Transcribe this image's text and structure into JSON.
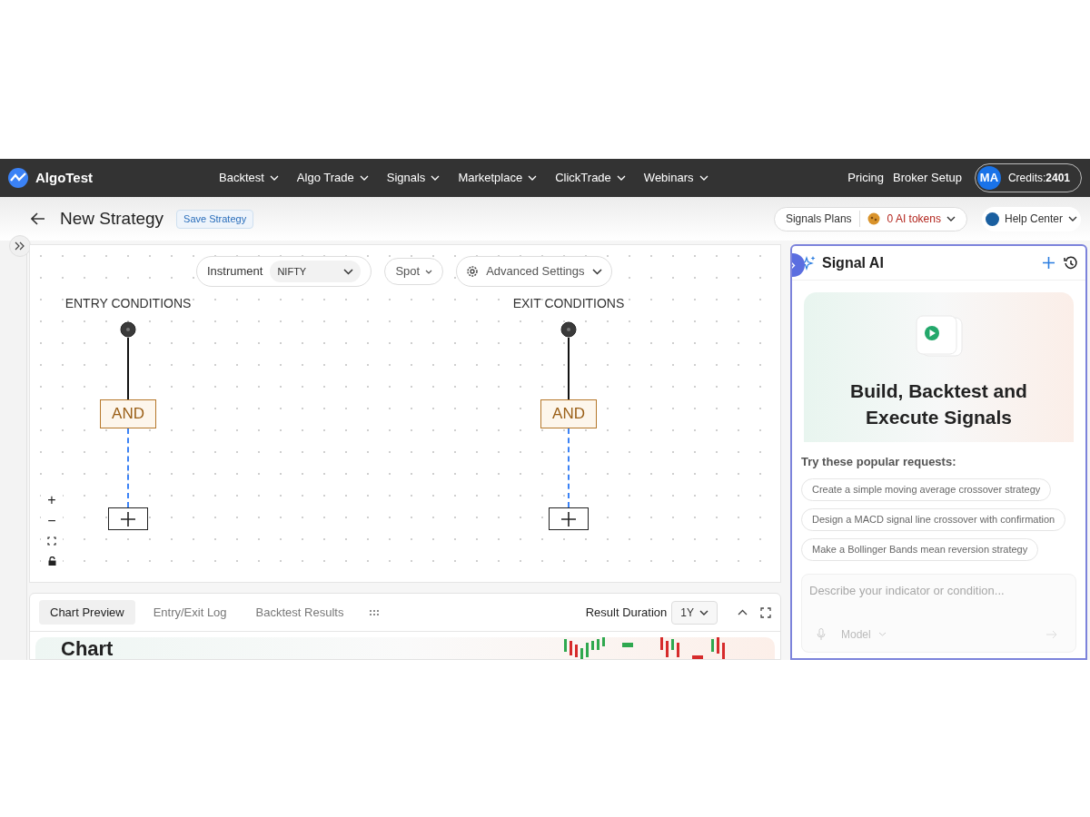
{
  "nav": {
    "brand": "AlgoTest",
    "menus": [
      {
        "label": "Backtest"
      },
      {
        "label": "Algo Trade"
      },
      {
        "label": "Signals"
      },
      {
        "label": "Marketplace"
      },
      {
        "label": "ClickTrade"
      },
      {
        "label": "Webinars"
      }
    ],
    "links": [
      "Pricing",
      "Broker Setup"
    ],
    "avatar": "MA",
    "credits_label": "Credits:",
    "credits_value": "2401"
  },
  "header": {
    "title": "New Strategy",
    "save_button": "Save Strategy",
    "signals_plans": "Signals Plans",
    "tokens": "0 AI tokens",
    "help": "Help Center"
  },
  "canvas": {
    "instrument_label": "Instrument",
    "instrument_value": "NIFTY",
    "spot": "Spot",
    "advanced": "Advanced Settings",
    "branches": [
      {
        "title": "ENTRY CONDITIONS",
        "operator": "AND"
      },
      {
        "title": "EXIT CONDITIONS",
        "operator": "AND"
      }
    ],
    "zoom_controls": [
      "+",
      "−"
    ]
  },
  "bottom_panel": {
    "tabs": [
      {
        "label": "Chart Preview",
        "selected": true
      },
      {
        "label": "Entry/Exit Log",
        "selected": false
      },
      {
        "label": "Backtest Results",
        "selected": false
      }
    ],
    "duration_label": "Result Duration",
    "duration_value": "1Y",
    "preview_heading": "Chart"
  },
  "assistant": {
    "title": "Signal AI",
    "hero": "Build, Backtest and Execute Signals",
    "prompt_heading": "Try these popular requests:",
    "suggestions": [
      "Create a simple moving average crossover strategy",
      "Design a MACD signal line crossover with confirmation",
      "Make a Bollinger Bands mean reversion strategy"
    ],
    "input_placeholder": "Describe your indicator or condition...",
    "model": "Model"
  }
}
